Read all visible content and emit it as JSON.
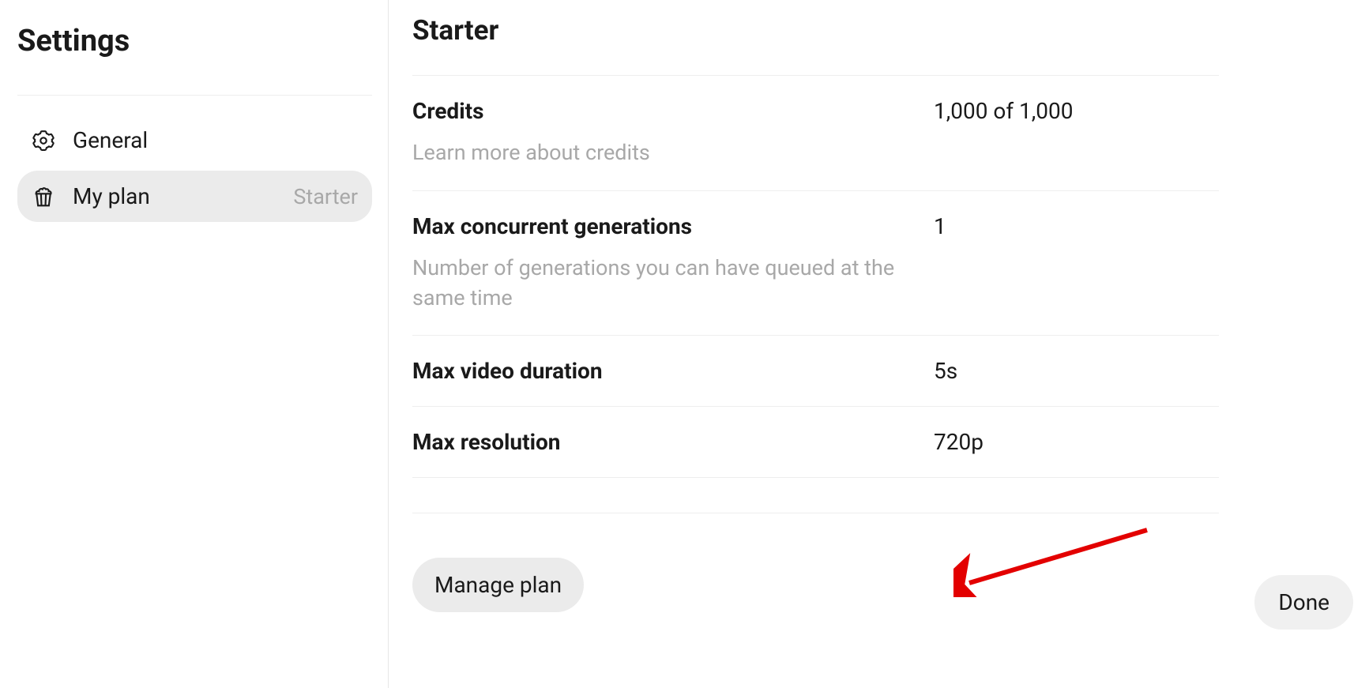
{
  "sidebar": {
    "title": "Settings",
    "items": [
      {
        "label": "General"
      },
      {
        "label": "My plan",
        "badge": "Starter"
      }
    ]
  },
  "plan": {
    "name": "Starter",
    "rows": [
      {
        "label": "Credits",
        "desc": "Learn more about credits",
        "value": "1,000 of 1,000"
      },
      {
        "label": "Max concurrent generations",
        "desc": "Number of generations you can have queued at the same time",
        "value": "1"
      },
      {
        "label": "Max video duration",
        "value": "5s"
      },
      {
        "label": "Max resolution",
        "value": "720p"
      }
    ],
    "manage_button": "Manage plan",
    "done_button": "Done"
  }
}
